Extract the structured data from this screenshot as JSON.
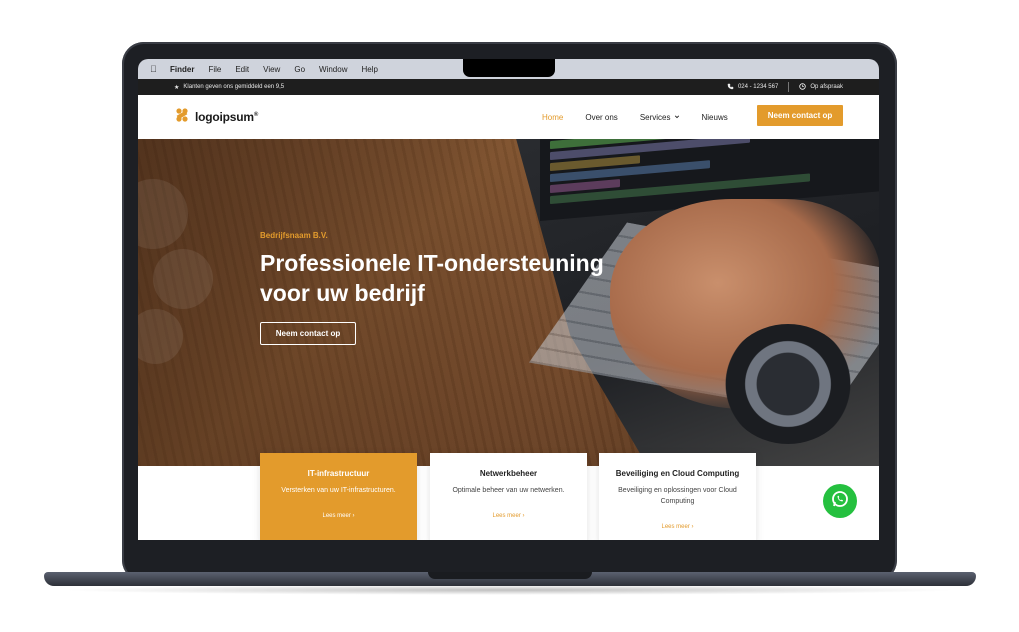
{
  "mac_menubar": {
    "items": [
      "Finder",
      "File",
      "Edit",
      "View",
      "Go",
      "Window",
      "Help"
    ]
  },
  "topbar": {
    "rating_text": "Klanten geven ons gemiddeld een 9,5",
    "phone": "024 - 1234 567",
    "appointment": "Op afspraak"
  },
  "header": {
    "logo_text": "logoipsum",
    "nav": [
      {
        "label": "Home",
        "active": true
      },
      {
        "label": "Over ons",
        "active": false
      },
      {
        "label": "Services",
        "active": false
      },
      {
        "label": "Nieuws",
        "active": false
      }
    ],
    "cta_label": "Neem contact op"
  },
  "hero": {
    "eyebrow": "Bedrijfsnaam B.V.",
    "title_line1": "Professionele IT-ondersteuning",
    "title_line2": "voor uw bedrijf",
    "button_label": "Neem contact op"
  },
  "cards": [
    {
      "title": "IT-infrastructuur",
      "text": "Versterken van uw IT-infrastructuren.",
      "link": "Lees meer ›"
    },
    {
      "title": "Netwerkbeheer",
      "text": "Optimale beheer van uw netwerken.",
      "link": "Lees meer ›"
    },
    {
      "title": "Beveiliging en Cloud Computing",
      "text": "Beveiliging en oplossingen voor Cloud Computing",
      "link": "Lees meer ›"
    }
  ],
  "colors": {
    "accent": "#e39b2c",
    "dark_bar": "#1e1e1e",
    "whatsapp": "#25c03f"
  }
}
